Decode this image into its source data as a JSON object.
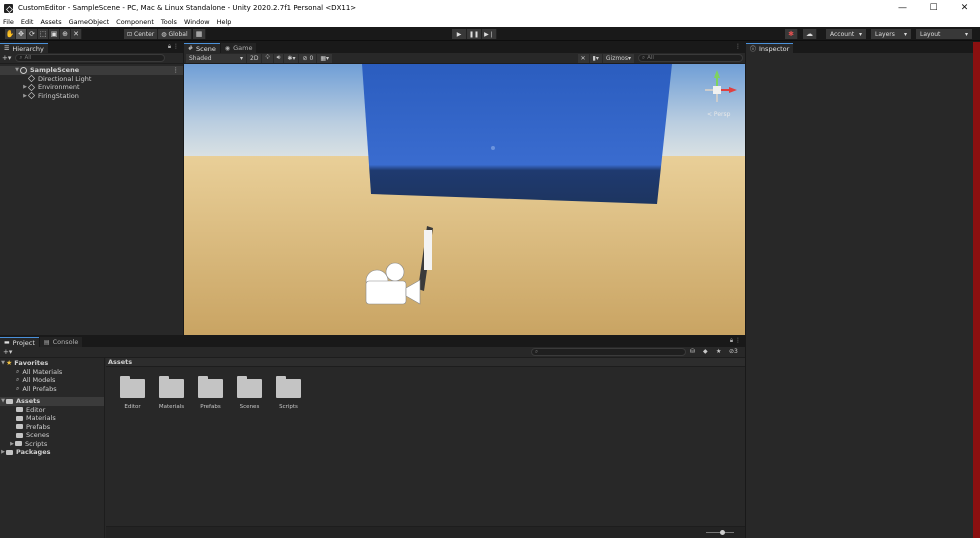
{
  "window": {
    "title": "CustomEditor - SampleScene - PC, Mac & Linux Standalone - Unity 2020.2.7f1 Personal <DX11>",
    "minimize": "—",
    "maximize": "☐",
    "close": "✕"
  },
  "menu": [
    "File",
    "Edit",
    "Assets",
    "GameObject",
    "Component",
    "Tools",
    "Window",
    "Help"
  ],
  "toolbar": {
    "pivot_label": "Center",
    "space_label": "Global",
    "play": "▶",
    "pause": "❚❚",
    "step": "▶❘",
    "account_label": "Account",
    "layers_label": "Layers",
    "layout_label": "Layout"
  },
  "hierarchy": {
    "tab": "Hierarchy",
    "search_placeholder": "All",
    "add": "+▾",
    "scene": "SampleScene",
    "items": [
      {
        "label": "Directional Light",
        "expandable": false
      },
      {
        "label": "Environment",
        "expandable": true
      },
      {
        "label": "FiringStation",
        "expandable": true
      }
    ]
  },
  "scene": {
    "tabs": [
      "Scene",
      "Game"
    ],
    "shading": "Shaded",
    "mode_2d": "2D",
    "hidden_count": "0",
    "gizmos": "Gizmos",
    "search_placeholder": "All",
    "gizmo_label": "< Persp"
  },
  "inspector": {
    "tab": "Inspector"
  },
  "project": {
    "tabs": [
      "Project",
      "Console"
    ],
    "add": "+▾",
    "hidden_count": "3",
    "favorites": {
      "label": "Favorites",
      "items": [
        "All Materials",
        "All Models",
        "All Prefabs"
      ]
    },
    "assets_root": {
      "label": "Assets",
      "items": [
        "Editor",
        "Materials",
        "Prefabs",
        "Scenes",
        "Scripts"
      ]
    },
    "packages_label": "Packages",
    "assets_header": "Assets",
    "folders": [
      "Editor",
      "Materials",
      "Prefabs",
      "Scenes",
      "Scripts"
    ]
  },
  "colors": {
    "accent": "#4a90d9",
    "sky_top": "#79a7d6",
    "sand": "#d9b97a",
    "blue_wall": "#2f5fc0",
    "panel_bg": "#282828"
  }
}
